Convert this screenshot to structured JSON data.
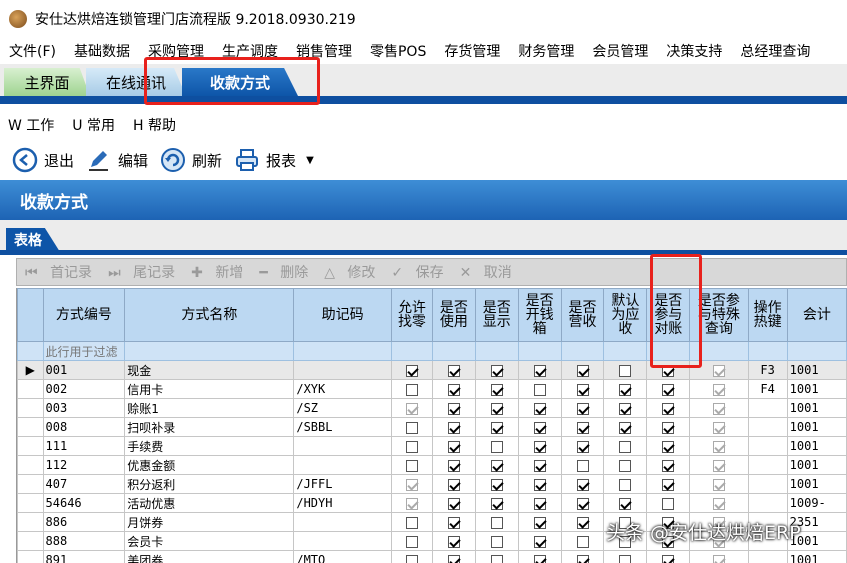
{
  "window": {
    "title": "安仕达烘焙连锁管理门店流程版 9.2018.0930.219"
  },
  "menu": [
    "文件(F)",
    "基础数据",
    "采购管理",
    "生产调度",
    "销售管理",
    "零售POS",
    "存货管理",
    "财务管理",
    "会员管理",
    "决策支持",
    "总经理查询"
  ],
  "tabs": {
    "home": "主界面",
    "online": "在线通讯",
    "pay": "收款方式"
  },
  "submenu": [
    "W 工作",
    "U 常用",
    "H 帮助"
  ],
  "toolbar": {
    "exit": "退出",
    "edit": "编辑",
    "refresh": "刷新",
    "report": "报表"
  },
  "header": {
    "title": "收款方式"
  },
  "subtab": {
    "label": "表格"
  },
  "grid_toolbar": [
    "首记录",
    "尾记录",
    "新增",
    "删除",
    "修改",
    "保存",
    "取消"
  ],
  "columns": [
    "方式编号",
    "方式名称",
    "助记码",
    "允许找零",
    "是否使用",
    "是否显示",
    "是否开钱箱",
    "是否营收",
    "默认为应收",
    "是否参与对账",
    "是否参与特殊查询",
    "操作热键",
    "会计"
  ],
  "filter_text": "此行用于过滤",
  "rows": [
    {
      "code": "001",
      "name": "现金",
      "mnem": "",
      "checks": [
        1,
        1,
        1,
        1,
        1,
        0,
        1,
        2
      ],
      "hotkey": "F3",
      "acct": "1001",
      "selected": true
    },
    {
      "code": "002",
      "name": "信用卡",
      "mnem": "/XYK",
      "checks": [
        0,
        1,
        1,
        0,
        1,
        1,
        1,
        2
      ],
      "hotkey": "F4",
      "acct": "1001"
    },
    {
      "code": "003",
      "name": "赊账1",
      "mnem": "/SZ",
      "checks": [
        2,
        1,
        1,
        1,
        1,
        1,
        1,
        2
      ],
      "hotkey": "",
      "acct": "1001"
    },
    {
      "code": "008",
      "name": "扫呗补录",
      "mnem": "/SBBL",
      "checks": [
        0,
        1,
        1,
        1,
        1,
        1,
        1,
        2
      ],
      "hotkey": "",
      "acct": "1001"
    },
    {
      "code": "111",
      "name": "手续费",
      "mnem": "",
      "checks": [
        0,
        1,
        0,
        1,
        1,
        0,
        1,
        2
      ],
      "hotkey": "",
      "acct": "1001"
    },
    {
      "code": "112",
      "name": "优惠金额",
      "mnem": "",
      "checks": [
        0,
        1,
        1,
        1,
        0,
        0,
        1,
        2
      ],
      "hotkey": "",
      "acct": "1001"
    },
    {
      "code": "407",
      "name": "积分返利",
      "mnem": "/JFFL",
      "checks": [
        2,
        1,
        1,
        1,
        1,
        0,
        1,
        2
      ],
      "hotkey": "",
      "acct": "1001"
    },
    {
      "code": "54646",
      "name": "活动优惠",
      "mnem": "/HDYH",
      "checks": [
        2,
        1,
        1,
        1,
        1,
        1,
        0,
        2
      ],
      "hotkey": "",
      "acct": "1009-"
    },
    {
      "code": "886",
      "name": "月饼券",
      "mnem": "",
      "checks": [
        0,
        1,
        0,
        1,
        1,
        0,
        1,
        2
      ],
      "hotkey": "",
      "acct": "2351"
    },
    {
      "code": "888",
      "name": "会员卡",
      "mnem": "",
      "checks": [
        0,
        1,
        0,
        1,
        0,
        0,
        1,
        2
      ],
      "hotkey": "",
      "acct": "1001"
    },
    {
      "code": "891",
      "name": "美团券",
      "mnem": "/MTQ",
      "checks": [
        0,
        1,
        0,
        1,
        1,
        0,
        1,
        2
      ],
      "hotkey": "",
      "acct": "1001"
    }
  ],
  "watermark": "头条 @安仕达烘焙ERP"
}
